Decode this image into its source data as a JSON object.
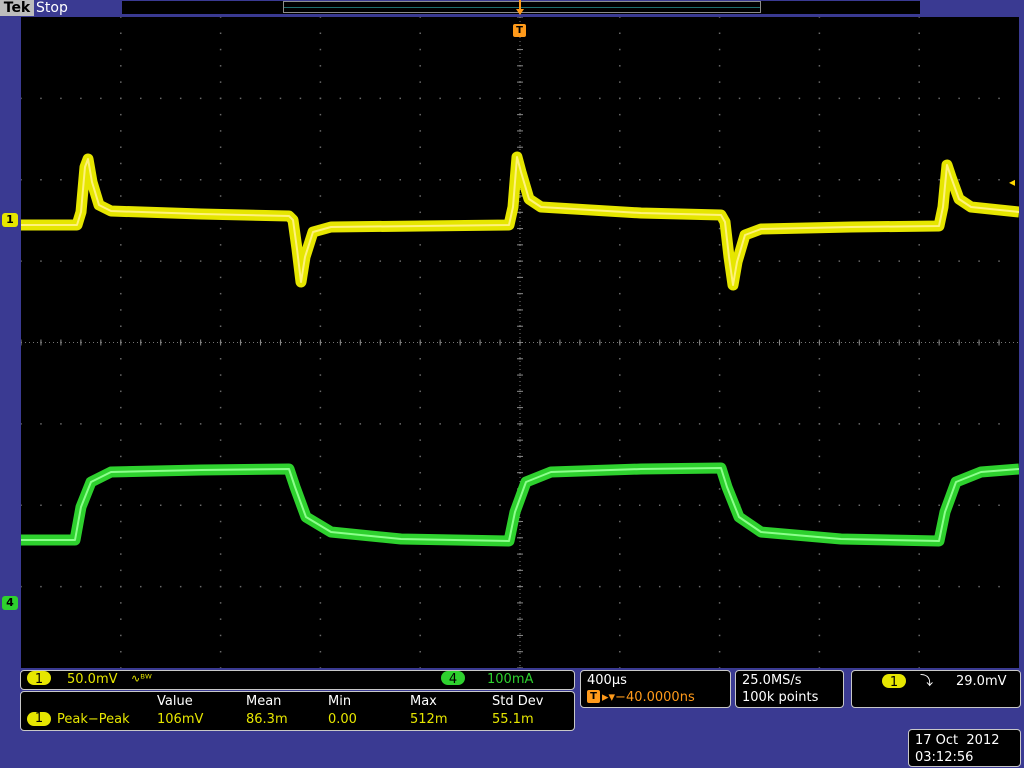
{
  "header": {
    "brand": "Tek",
    "status": "Stop",
    "trigger_marker": "T"
  },
  "channels": {
    "ch1": {
      "marker": "1",
      "scale": "50.0mV",
      "coupling_symbol": "∿ᴮᵂ",
      "color": "#e6e600"
    },
    "ch4": {
      "marker": "4",
      "scale": "100mA",
      "color": "#2ed12e"
    }
  },
  "measurement": {
    "headers": [
      "Value",
      "Mean",
      "Min",
      "Max",
      "Std Dev"
    ],
    "row": {
      "source": "1",
      "name": "Peak−Peak",
      "value": "106mV",
      "mean": "86.3m",
      "min": "0.00",
      "max": "512m",
      "std_dev": "55.1m"
    }
  },
  "timebase": {
    "scale": "400µs",
    "delay_icon": "T",
    "delay": "▸▾−40.0000ns"
  },
  "acquisition": {
    "sample_rate": "25.0MS/s",
    "record_length": "100k points"
  },
  "trigger": {
    "source": "1",
    "slope_symbol": "⤵",
    "level": "29.0mV",
    "level_marker": "◂"
  },
  "clock": {
    "date": "17 Oct  2012",
    "time": "03:12:56"
  },
  "colors": {
    "background": "#000000",
    "frame": "#3a3a92",
    "ch1": "#e6e600",
    "ch4": "#2ed12e",
    "trigger": "#ff9a1a"
  }
}
